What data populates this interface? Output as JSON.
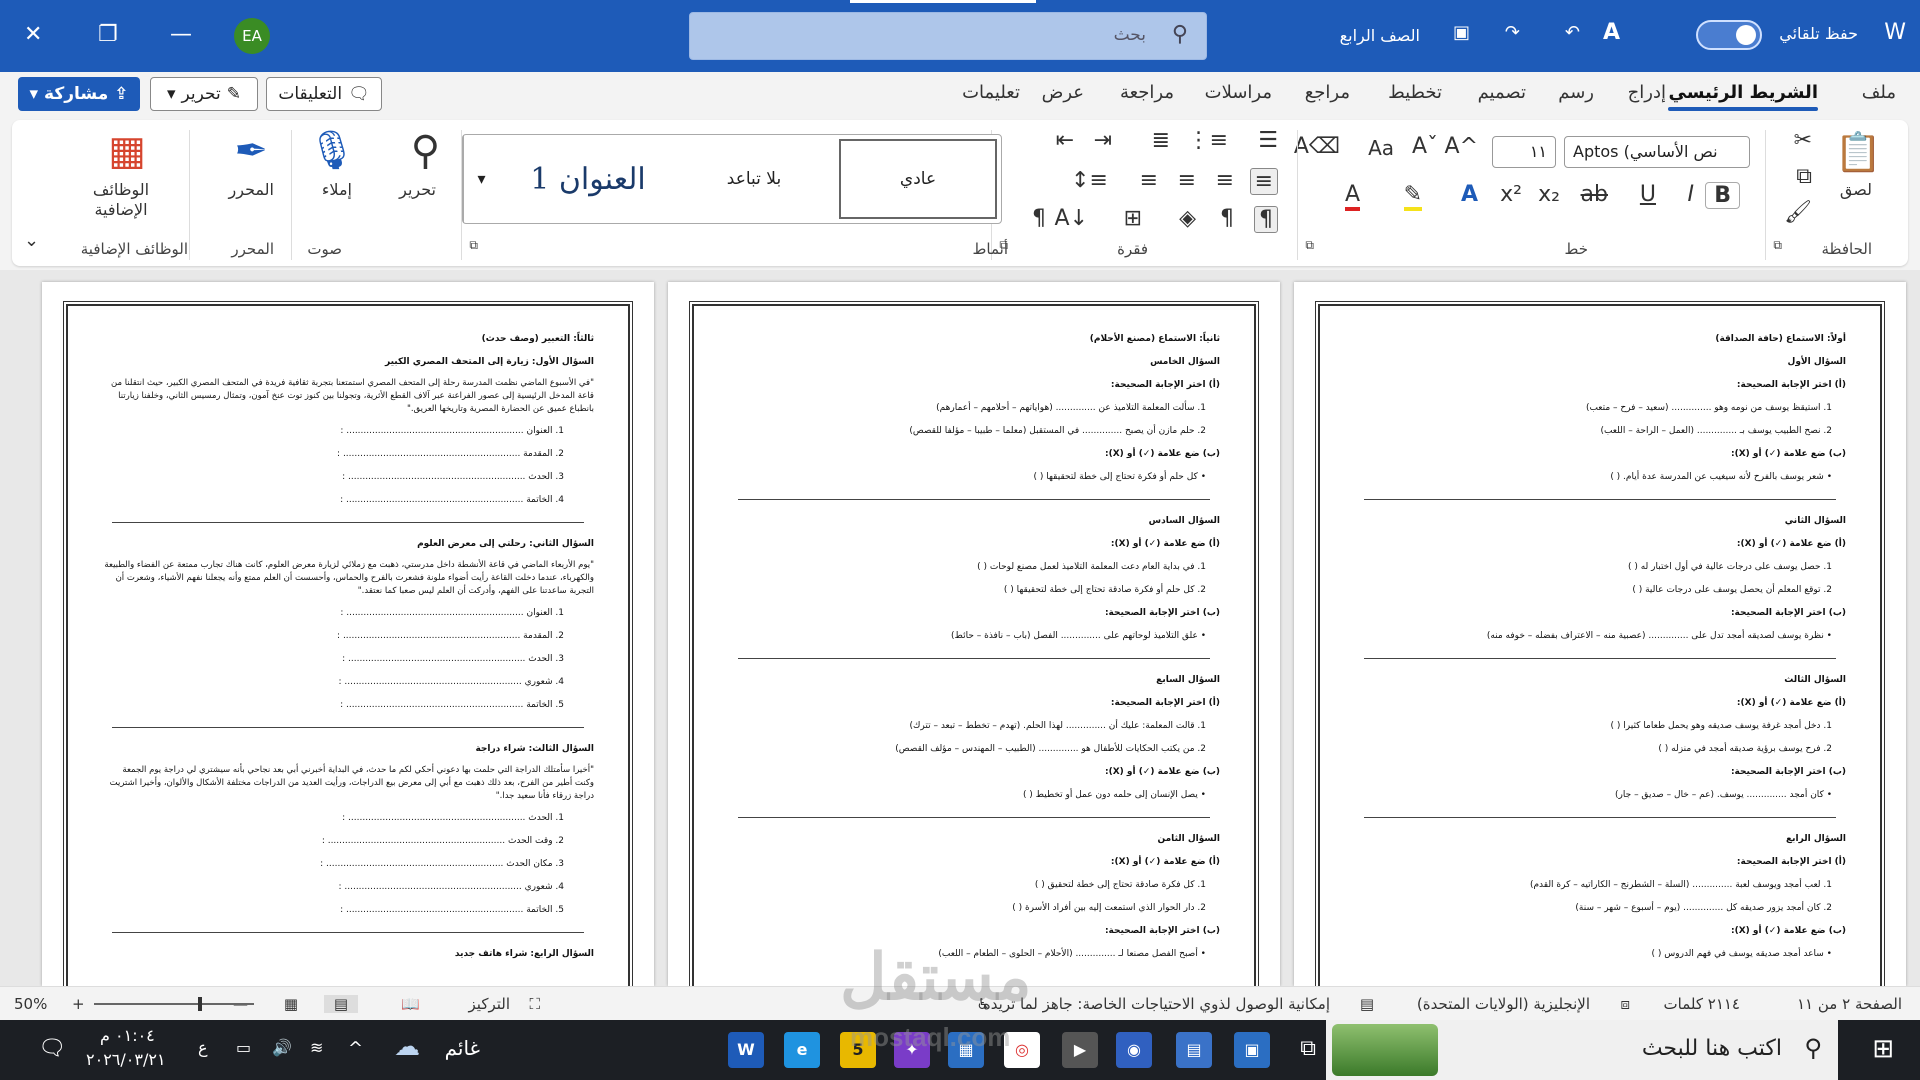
{
  "titlebar": {
    "search_placeholder": "بحث",
    "autosave_label": "حفظ تلقائي",
    "style_label": "الصف الرابع",
    "avatar": "EA",
    "minimize": "—",
    "restore": "❐",
    "close": "✕"
  },
  "menu": {
    "tabs": [
      "ملف",
      "الشريط الرئيسي",
      "إدراج",
      "رسم",
      "تصميم",
      "تخطيط",
      "مراجع",
      "مراسلات",
      "مراجعة",
      "عرض",
      "تعليمات"
    ],
    "share": "مشاركة",
    "edit": "تحرير",
    "comments": "التعليقات"
  },
  "ribbon": {
    "clipboard": {
      "label": "الحافظة",
      "paste": "لصق"
    },
    "font": {
      "label": "خط",
      "font_name": "Aptos (نص الأساسي",
      "font_size": "١١"
    },
    "paragraph": {
      "label": "فقرة"
    },
    "styles": {
      "label": "أنماط",
      "normal": "عادي",
      "no_spacing": "بلا تباعد",
      "heading1": "العنوان 1"
    },
    "voice": {
      "label": "صوت",
      "dictate": "إملاء",
      "edit": "تحرير"
    },
    "editor": {
      "label": "المحرر",
      "button": "المحرر"
    },
    "addins": {
      "label": "الوظائف الإضافية",
      "button": "الوظائف الإضافية"
    }
  },
  "pages": {
    "p1": {
      "title": "أولاً: الاستماع (حافة الصداقة)",
      "blocks": [
        {
          "q": "السؤال الأول"
        },
        {
          "h": "(أ) اختر الإجابة الصحيحة:"
        },
        {
          "l": "1. استيقظ يوسف من نومه وهو .............. (سعيد – فرح – متعب)"
        },
        {
          "l": "2. نصح الطبيب يوسف بـ .............. (العمل – الراحة – اللعب)"
        },
        {
          "h": "(ب) ضع علامة (✓) أو (X):"
        },
        {
          "l": "• شعر يوسف بالفرح لأنه سيغيب عن المدرسة عدة أيام. ( )"
        },
        {
          "hr": true
        },
        {
          "q": "السؤال الثاني"
        },
        {
          "h": "(أ) ضع علامة (✓) أو (X):"
        },
        {
          "l": "1. حصل يوسف على درجات عالية في أول اختبار له ( )"
        },
        {
          "l": "2. توقع المعلم أن يحصل يوسف على درجات عالية ( )"
        },
        {
          "h": "(ب) اختر الإجابة الصحيحة:"
        },
        {
          "l": "• نظرة يوسف لصديقه أمجد تدل على .............. (عصبية منه – الاعتراف بفضله – خوفه منه)"
        },
        {
          "hr": true
        },
        {
          "q": "السؤال الثالث"
        },
        {
          "h": "(أ) ضع علامة (✓) أو (X):"
        },
        {
          "l": "1. دخل أمجد غرفة يوسف صديقه وهو يحمل طعاما كثيرا ( )"
        },
        {
          "l": "2. فرح يوسف برؤية صديقه أمجد في منزله ( )"
        },
        {
          "h": "(ب) اختر الإجابة الصحيحة:"
        },
        {
          "l": "• كان أمجد .............. يوسف. (عم – خال – صديق – جار)"
        },
        {
          "hr": true
        },
        {
          "q": "السؤال الرابع"
        },
        {
          "h": "(أ) اختر الإجابة الصحيحة:"
        },
        {
          "l": "1. لعب أمجد ويوسف لعبة .............. (السلة – الشطرنج – الكاراتيه – كرة القدم)"
        },
        {
          "l": "2. كان أمجد يزور صديقه كل .............. (يوم – أسبوع – شهر – سنة)"
        },
        {
          "h": "(ب) ضع علامة (✓) أو (X):"
        },
        {
          "l": "• ساعد أمجد صديقه يوسف في فهم الدروس ( )"
        }
      ]
    },
    "p2": {
      "title": "ثانياً: الاستماع (مصنع الأحلام)",
      "blocks": [
        {
          "q": "السؤال الخامس"
        },
        {
          "h": "(أ) اختر الإجابة الصحيحة:"
        },
        {
          "l": "1. سألت المعلمة التلاميذ عن .............. (هواياتهم – أحلامهم – أعمارهم)"
        },
        {
          "l": "2. حلم مازن أن يصبح .............. في المستقبل (معلما – طبيبا – مؤلفا للقصص)"
        },
        {
          "h": "(ب) ضع علامة (✓) أو (X):"
        },
        {
          "l": "• كل حلم أو فكرة تحتاج إلى خطة لتحقيقها ( )"
        },
        {
          "hr": true
        },
        {
          "q": "السؤال السادس"
        },
        {
          "h": "(أ) ضع علامة (✓) أو (X):"
        },
        {
          "l": "1. في بداية العام دعت المعلمة التلاميذ لعمل مصنع لوحات ( )"
        },
        {
          "l": "2. كل حلم أو فكرة صادقة تحتاج إلى خطة لتحقيقها ( )"
        },
        {
          "h": "(ب) اختر الإجابة الصحيحة:"
        },
        {
          "l": "• علق التلاميذ لوحاتهم على .............. الفصل (باب – نافذة – حائط)"
        },
        {
          "hr": true
        },
        {
          "q": "السؤال السابع"
        },
        {
          "h": "(أ) اختر الإجابة الصحيحة:"
        },
        {
          "l": "1. قالت المعلمة: عليك أن .............. لهذا الحلم. (تهدم – تخطط – تبعد – تترك)"
        },
        {
          "l": "2. من يكتب الحكايات للأطفال هو .............. (الطبيب – المهندس – مؤلف القصص)"
        },
        {
          "h": "(ب) ضع علامة (✓) أو (X):"
        },
        {
          "l": "• يصل الإنسان إلى حلمه دون عمل أو تخطيط ( )"
        },
        {
          "hr": true
        },
        {
          "q": "السؤال الثامن"
        },
        {
          "h": "(أ) ضع علامة (✓) أو (X):"
        },
        {
          "l": "1. كل فكرة صادقة تحتاج إلى خطة لتحقيق ( )"
        },
        {
          "l": "2. دار الحوار الذي استمعت إليه بين أفراد الأسرة ( )"
        },
        {
          "h": "(ب) اختر الإجابة الصحيحة:"
        },
        {
          "l": "• أصبح الفصل مصنعا لـ .............. (الأحلام – الحلوى – الطعام – اللعب)"
        }
      ]
    },
    "p3": {
      "title": "ثالثاً: التعبير (وصف حدث)",
      "blocks": [
        {
          "q": "السؤال الأول: زيارة إلى المتحف المصري الكبير"
        },
        {
          "p": "\"في الأسبوع الماضي نظمت المدرسة رحلة إلى المتحف المصري استمتعنا بتجربة ثقافية فريدة في المتحف المصري الكبير، حيث انتقلنا من قاعة المدخل الرئيسية إلى عصور الفراعنة عبر آلاف القطع الأثرية، وتجولنا بين كنوز توت عنخ آمون، وتمثال رمسيس الثاني، وخلفنا زيارتنا بانطباع عميق عن الحضارة المصرية وتاريخها العريق.\""
        },
        {
          "f": "1. العنوان .............................................................. :"
        },
        {
          "f": "2. المقدمة .............................................................. :"
        },
        {
          "f": "3. الحدث .............................................................. :"
        },
        {
          "f": "4. الخاتمة .............................................................. :"
        },
        {
          "hr": true
        },
        {
          "q": "السؤال الثاني: رحلتي إلى معرض العلوم"
        },
        {
          "p": "\"يوم الأربعاء الماضي في قاعة الأنشطة داخل مدرستي، ذهبت مع زملائي لزيارة معرض العلوم، كانت هناك تجارب ممتعة عن الفضاء والطبيعة والكهرباء، عندما دخلت القاعة رأيت أضواء ملونة فشعرت بالفرح والحماس، وأحسست أن العلم ممتع وأنه يجعلنا نفهم الأشياء، وشعرت أن التجربة ساعدتنا على الفهم، وأدركت أن العلم ليس صعبا كما نعتقد.\""
        },
        {
          "f": "1. العنوان .............................................................. :"
        },
        {
          "f": "2. المقدمة .............................................................. :"
        },
        {
          "f": "3. الحدث .............................................................. :"
        },
        {
          "f": "4. شعوري .............................................................. :"
        },
        {
          "f": "5. الخاتمة .............................................................. :"
        },
        {
          "hr": true
        },
        {
          "q": "السؤال الثالث: شراء دراجة"
        },
        {
          "p": "\"أخيرا سأمتلك الدراجة التي حلمت بها دعوني أحكي لكم ما حدث، في البداية أخبرني أبي بعد نجاحي بأنه سيشتري لي دراجة يوم الجمعة وكنت أطير من الفرح، بعد ذلك ذهبت مع أبي إلى معرض بيع الدراجات، ورأيت العديد من الدراجات مختلفة الأشكال والألوان، وأخيرا اشتريت دراجة زرقاء فأنا سعيد جدا.\""
        },
        {
          "f": "1. الحدث .............................................................. :"
        },
        {
          "f": "2. وقت الحدث .............................................................. :"
        },
        {
          "f": "3. مكان الحدث .............................................................. :"
        },
        {
          "f": "4. شعوري .............................................................. :"
        },
        {
          "f": "5. الخاتمة .............................................................. :"
        },
        {
          "hr": true
        },
        {
          "q": "السؤال الرابع: شراء هاتف جديد"
        }
      ]
    }
  },
  "statusbar": {
    "page": "الصفحة ٢ من ١١",
    "words": "٢١١٤ كلمات",
    "language": "الإنجليزية (الولايات المتحدة)",
    "accessibility": "إمكانية الوصول لذوي الاحتياجات الخاصة: جاهز لما تريده",
    "focus": "التركيز",
    "zoom": "50%"
  },
  "taskbar": {
    "search_placeholder": "اكتب هنا للبحث",
    "weather": "غائم",
    "time": "٠١:٠٤ م",
    "date": "٢٠٢٦/٠٣/٢١",
    "lang": "ع"
  },
  "watermark": {
    "logo": "مستقل",
    "site": "mostaql.com"
  },
  "colors": {
    "accent": "#1e5bb8",
    "taskbar": "#1c1f24"
  }
}
